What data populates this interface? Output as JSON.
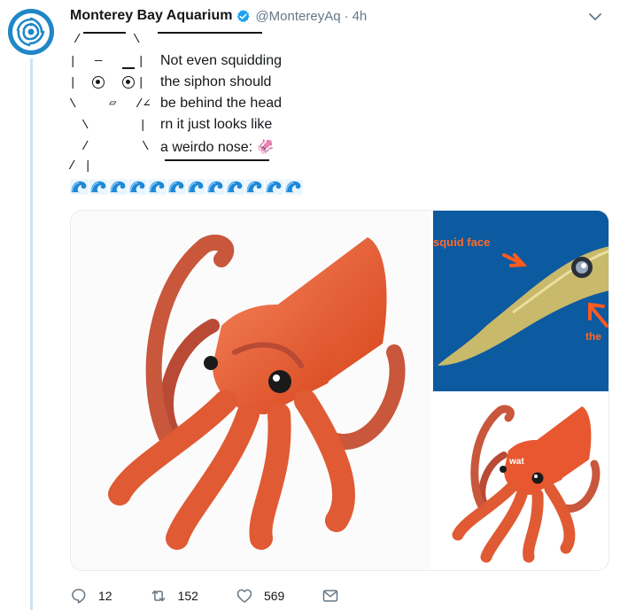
{
  "tweet": {
    "display_name": "Monterey Bay Aquarium",
    "handle": "@MontereyAq",
    "separator": "·",
    "time": "4h",
    "text_lines": [
      "Not even squidding",
      "the siphon should",
      "be behind the head",
      "rn it just looks like",
      "a weirdo nose: 🦑"
    ],
    "ascii_marks": {
      "slash": "/",
      "backslash": "\\",
      "pipe": "|",
      "dash": "—",
      "nose": "▱",
      "mouth": "/∠"
    },
    "wave_count": 12,
    "media": {
      "label_squid_face": "squid face",
      "label_the": "the",
      "label_wat": "wat"
    },
    "actions": {
      "reply_count": "12",
      "retweet_count": "152",
      "like_count": "569"
    }
  },
  "colors": {
    "accent_blue": "#1da1f2",
    "thread_line": "#cce3f5",
    "squid_orange": "#e8572f",
    "text_secondary": "#657786"
  }
}
